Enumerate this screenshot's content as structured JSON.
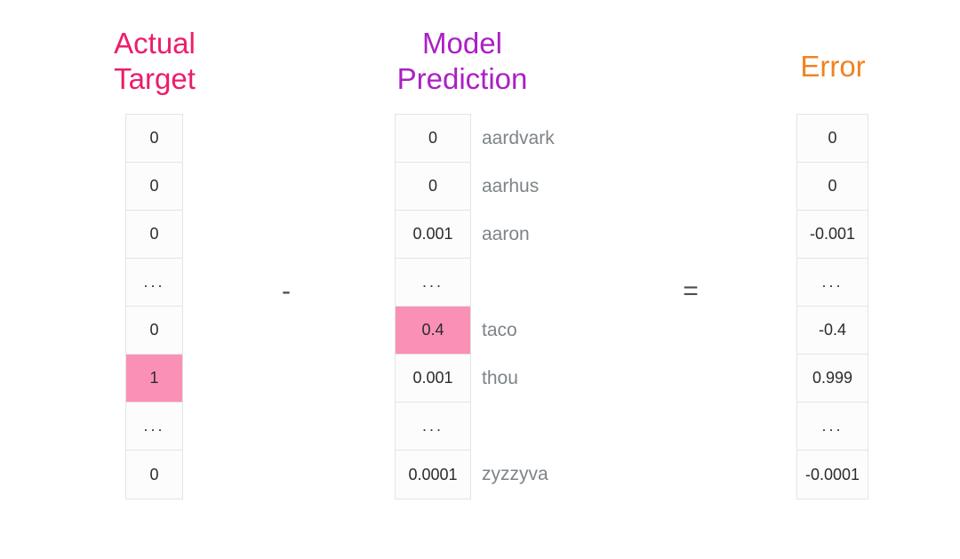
{
  "headings": {
    "actual_target": "Actual\nTarget",
    "model_prediction": "Model\nPrediction",
    "error": "Error"
  },
  "colors": {
    "actual_target": "#ec1d6b",
    "model_prediction": "#ab20c4",
    "error": "#f08322",
    "highlight": "#fa90b5",
    "cell_border": "#e2e4e6",
    "cell_text": "#2b2b2b",
    "word_label": "#7e8488",
    "operator": "#4a4f57",
    "background": "#ffffff"
  },
  "operators": {
    "minus": "-",
    "equals": "="
  },
  "rows": [
    {
      "word": "aardvark",
      "target": "0",
      "prediction": "0",
      "error": "0",
      "highlight": false,
      "ellipsis": false
    },
    {
      "word": "aarhus",
      "target": "0",
      "prediction": "0",
      "error": "0",
      "highlight": false,
      "ellipsis": false
    },
    {
      "word": "aaron",
      "target": "0",
      "prediction": "0.001",
      "error": "-0.001",
      "highlight": false,
      "ellipsis": false
    },
    {
      "word": "",
      "target": "...",
      "prediction": "...",
      "error": "...",
      "highlight": false,
      "ellipsis": true
    },
    {
      "word": "taco",
      "target": "0",
      "prediction": "0.4",
      "error": "-0.4",
      "highlight": true,
      "ellipsis": false
    },
    {
      "word": "thou",
      "target": "1",
      "prediction": "0.001",
      "error": "0.999",
      "highlight": false,
      "ellipsis": false
    },
    {
      "word": "",
      "target": "...",
      "prediction": "...",
      "error": "...",
      "highlight": false,
      "ellipsis": true
    },
    {
      "word": "zyzzyva",
      "target": "0",
      "prediction": "0.0001",
      "error": "-0.0001",
      "highlight": false,
      "ellipsis": false
    }
  ],
  "highlight_cells": {
    "target_row_index": 5,
    "prediction_row_index": 4
  }
}
